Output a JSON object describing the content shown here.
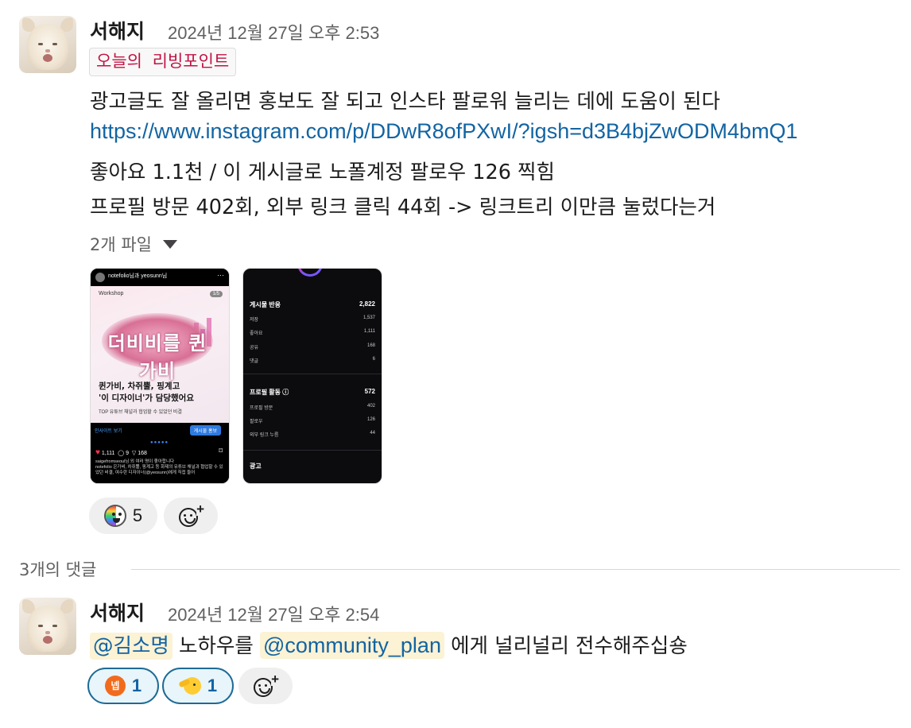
{
  "message": {
    "author": "서해지",
    "timestamp": "2024년 12월 27일 오후 2:53",
    "tag": "오늘의 리빙포인트",
    "line1": "광고글도 잘 올리면 홍보도 잘 되고 인스타 팔로워 늘리는 데에 도움이 된다",
    "link": "https://www.instagram.com/p/DDwR8ofPXwI/?igsh=d3B4bjZwODM4bmQ1",
    "line3": "좋아요 1.1천 / 이 게시글로 노폴계정 팔로우 126 찍힘",
    "line4": "프로필 방문 402회, 외부 링크 클릭 44회 -> 링크트리 이만큼 눌렀다는거",
    "files_label": "2개 파일",
    "files": [
      {
        "username": "notefolio님과 yeosunn님",
        "section": "Workshop",
        "page": "1/5",
        "poster_title": "더비비를 퀸가비",
        "headline1": "퀸가비, 차쥐뿔, 핑계고",
        "headline2": "'이 디자이너'가 담당했어요",
        "subline": "TOP 유튜브 채널과 협업할 수 있었던 비결",
        "insights_link": "인사이트 보기",
        "boost_button": "게시물 홍보",
        "likes": "1,111",
        "comments": "9",
        "shares": "168",
        "caption_liked": "saigefromseoul님 외 여러 명이 좋아합니다",
        "caption": "notefolio 은가비, 차쥐뿔, 핑계고 등 화제의 유튜브 채널과 협업할 수 있었던 비결, 여수란 디자이너(@yeosunn)에게 직접 들어"
      },
      {
        "sections": [
          {
            "title": "게시물 반응",
            "total": "2,822",
            "rows": [
              {
                "label": "저장",
                "value": "1,537"
              },
              {
                "label": "좋아요",
                "value": "1,111"
              },
              {
                "label": "공유",
                "value": "168"
              },
              {
                "label": "댓글",
                "value": "6"
              }
            ]
          },
          {
            "title": "프로필 활동 ⓘ",
            "total": "572",
            "rows": [
              {
                "label": "프로필 방문",
                "value": "402"
              },
              {
                "label": "팔로우",
                "value": "126"
              },
              {
                "label": "외부 링크 누름",
                "value": "44"
              }
            ]
          },
          {
            "title": "광고",
            "total": "",
            "rows": []
          }
        ]
      }
    ],
    "reactions": [
      {
        "emoji": "party-face-emoji",
        "count": "5"
      }
    ]
  },
  "thread": {
    "label": "3개의 댓글"
  },
  "reply": {
    "author": "서해지",
    "timestamp": "2024년 12월 27일 오후 2:54",
    "mention1": "@김소명",
    "text1": "노하우를",
    "mention2": "@community_plan",
    "text2": "에게 널리널리 전수해주십숑",
    "reactions": [
      {
        "emoji": "nep-emoji",
        "glyph": "넵",
        "count": "1"
      },
      {
        "emoji": "salute-face-emoji",
        "count": "1"
      }
    ]
  },
  "colors": {
    "link": "#1264a3",
    "tag_text": "#c01343",
    "mention_bg": "#fcf2d4",
    "reaction_mine_border": "#1d6b96",
    "nep_badge": "#f26b1d"
  }
}
